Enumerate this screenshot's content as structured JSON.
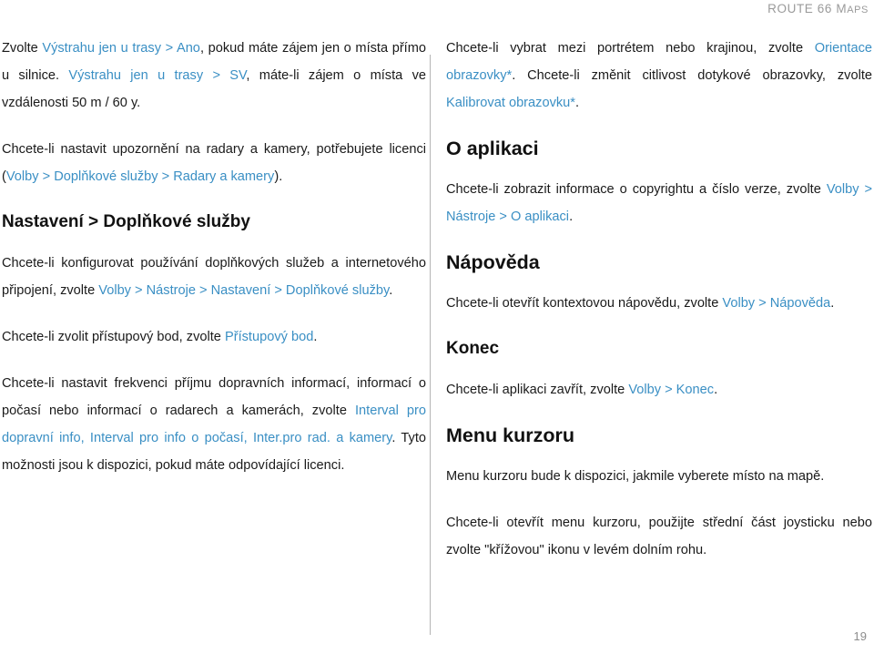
{
  "header": {
    "title_main": "ROUTE 66 ",
    "title_smallcaps_first": "M",
    "title_smallcaps_rest": "APS"
  },
  "left_column": {
    "p1": {
      "t1": "Zvolte ",
      "link1": "Výstrahu jen u trasy > Ano",
      "t2": ", pokud máte zájem jen o místa přímo u silnice. ",
      "link2": "Výstrahu jen u trasy > SV",
      "t3": ", máte-li zájem o místa ve vzdálenosti 50 m / 60 y."
    },
    "p2": {
      "t1": "Chcete-li nastavit upozornění na radary a kamery, potřebujete licenci (",
      "link1": "Volby > Doplňkové služby > Radary a kamery",
      "t2": ")."
    },
    "heading1": "Nastavení > Doplňkové služby",
    "p3": {
      "t1": "Chcete-li konfigurovat používání doplňkových služeb a internetového připojení, zvolte ",
      "link1": "Volby > Nástroje > Nastavení > Doplňkové služby",
      "t2": "."
    },
    "p4": {
      "t1": "Chcete-li zvolit přístupový bod, zvolte ",
      "link1": "Přístupový bod",
      "t2": "."
    },
    "p5": {
      "t1": "Chcete-li nastavit frekvenci příjmu dopravních informací, informací o počasí nebo informací o radarech a kamerách, zvolte ",
      "link1": "Interval pro dopravní info, Interval pro info o počasí, Inter.pro rad. a kamery",
      "t2": ". Tyto možnosti jsou k dispozici, pokud máte odpovídající licenci."
    }
  },
  "right_column": {
    "p1": {
      "t1": "Chcete-li vybrat mezi portrétem nebo krajinou, zvolte ",
      "link1": "Orientace obrazovky*",
      "t2": ". Chcete-li změnit citlivost dotykové obrazovky, zvolte ",
      "link2": "Kalibrovat obrazovku*",
      "t3": "."
    },
    "heading1": "O aplikaci",
    "p2": {
      "t1": "Chcete-li zobrazit informace o copyrightu a číslo verze, zvolte ",
      "link1": "Volby > Nástroje > O aplikaci",
      "t2": "."
    },
    "heading2": "Nápověda",
    "p3": {
      "t1": "Chcete-li otevřít kontextovou nápovědu, zvolte ",
      "link1": "Volby > Nápověda",
      "t2": "."
    },
    "heading3": "Konec",
    "p4": {
      "t1": "Chcete-li aplikaci zavřít, zvolte ",
      "link1": "Volby > Konec",
      "t2": "."
    },
    "heading4": "Menu kurzoru",
    "p5": {
      "t1": "Menu kurzoru bude k dispozici, jakmile vyberete místo na mapě."
    },
    "p6": {
      "t1": "Chcete-li otevřít menu kurzoru, použijte střední část joysticku nebo zvolte \"křížovou\" ikonu v levém dolním rohu."
    }
  },
  "footer": {
    "page_number": "19"
  },
  "colors": {
    "link": "#3a8fc4",
    "text": "#1a1a1a",
    "muted": "#9a9a9a",
    "divider": "#b4b4b4"
  }
}
